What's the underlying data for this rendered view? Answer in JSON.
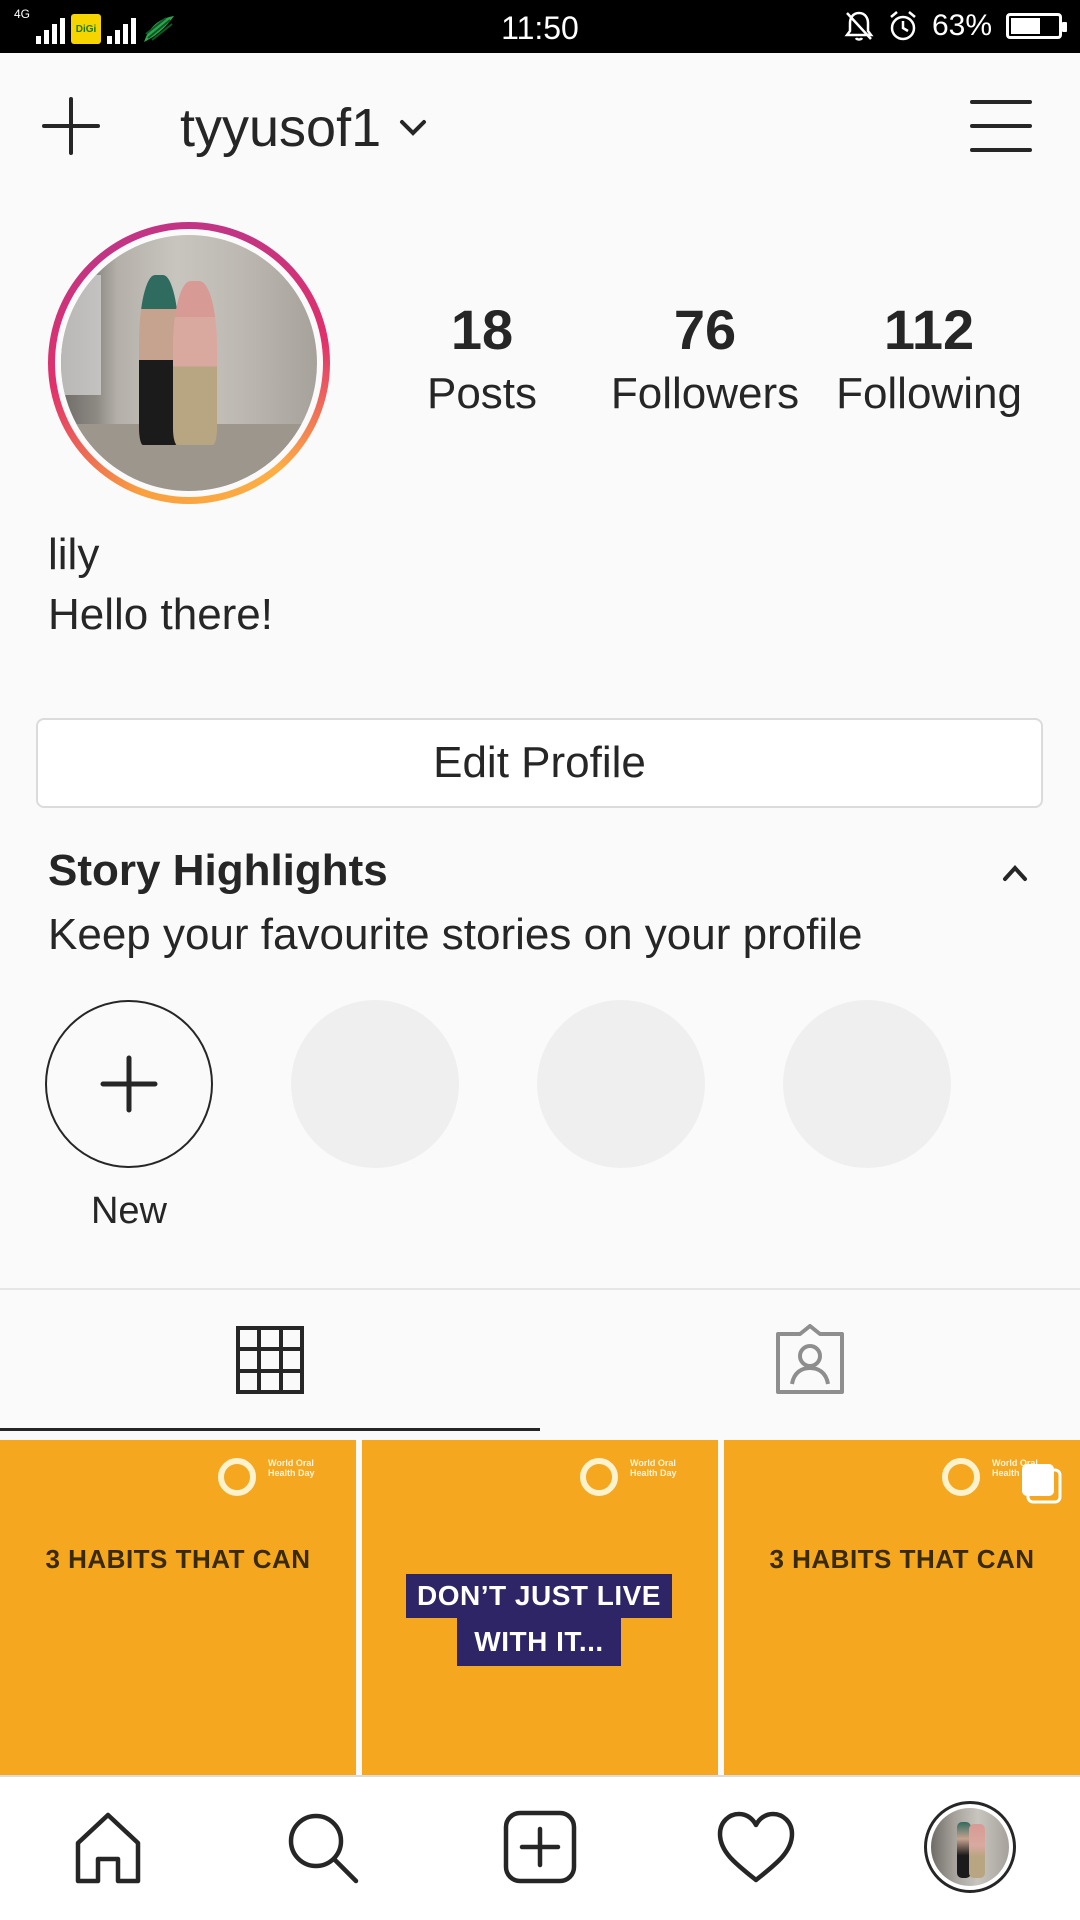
{
  "status_bar": {
    "network": "4G",
    "carrier": "DiGi",
    "time": "11:50",
    "battery": "63%",
    "battery_level": 0.63
  },
  "header": {
    "username": "tyyusof1"
  },
  "profile": {
    "stats": [
      {
        "value": "18",
        "label": "Posts"
      },
      {
        "value": "76",
        "label": "Followers"
      },
      {
        "value": "112",
        "label": "Following"
      }
    ],
    "name": "lily",
    "bio": "Hello there!",
    "edit_profile_label": "Edit Profile"
  },
  "story_highlights": {
    "title": "Story Highlights",
    "subtitle": "Keep your favourite stories on your profile",
    "new_label": "New"
  },
  "posts": [
    {
      "headline": "3 HABITS THAT CAN",
      "logo_text": "World Oral Health Day"
    },
    {
      "box_line1": "DON’T JUST LIVE",
      "box_line2": "WITH IT...",
      "logo_text": "World Oral Health Day"
    },
    {
      "headline": "3 HABITS THAT CAN",
      "logo_text": "World Oral Health Day"
    }
  ],
  "colors": {
    "accent_gradient": [
      "#f9a03f",
      "#e1306c",
      "#c13584"
    ],
    "post_background": "#f4a71f",
    "text": "#262626"
  },
  "icons": {
    "header_left": "plus-icon",
    "header_dropdown": "chevron-down-icon",
    "header_right": "hamburger-menu-icon",
    "tabs": [
      "grid-icon",
      "tagged-person-icon"
    ],
    "nav": [
      "home-icon",
      "search-icon",
      "add-post-icon",
      "heart-icon",
      "profile-avatar"
    ]
  }
}
